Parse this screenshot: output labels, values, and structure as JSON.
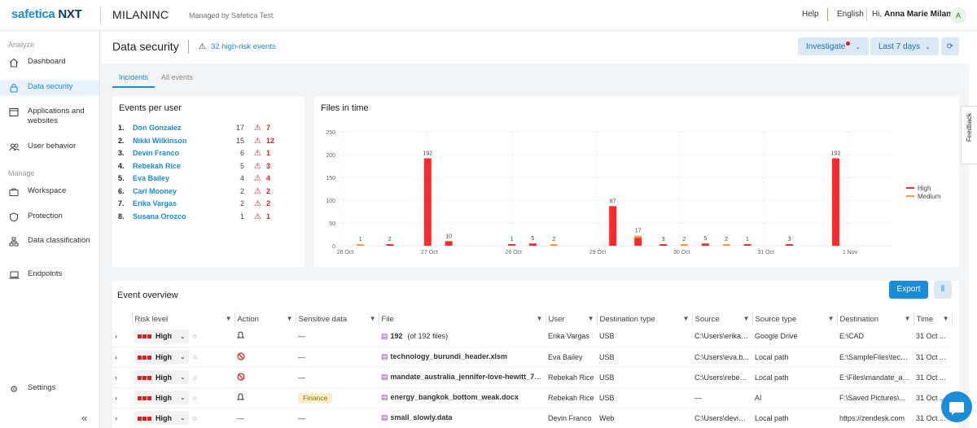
{
  "app": {
    "brand_main": "safetica",
    "brand_suffix": " NXT",
    "company": "MILANINC",
    "managed_by": "Managed by Safetica Test"
  },
  "topnav": {
    "help": "Help",
    "language": "English",
    "greeting": "Hi, ",
    "user_name": "Anna Marie Milan",
    "avatar_initial": "A"
  },
  "sidebar": {
    "analyze_title": "Analyze",
    "manage_title": "Manage",
    "items": [
      {
        "label": "Dashboard",
        "icon": "home-icon"
      },
      {
        "label": "Data security",
        "icon": "lock-icon",
        "active": true
      },
      {
        "label": "Applications and websites",
        "icon": "app-window-icon"
      },
      {
        "label": "User behavior",
        "icon": "users-icon"
      },
      {
        "label": "Workspace",
        "icon": "briefcase-icon"
      },
      {
        "label": "Protection",
        "icon": "shield-icon"
      },
      {
        "label": "Data classification",
        "icon": "hierarchy-icon"
      },
      {
        "label": "Endpoints",
        "icon": "laptop-icon"
      },
      {
        "label": "Settings",
        "icon": "gear-icon"
      }
    ]
  },
  "page": {
    "title": "Data security",
    "alert_text": "32 high-risk events",
    "investigate": "Investigate",
    "period": "Last 7 days",
    "tabs": [
      "Incidents",
      "All events"
    ]
  },
  "events_per_user": {
    "title": "Events per user",
    "rows": [
      {
        "rank": "1.",
        "name": "Don Gonzalez",
        "count": "17",
        "high": "7"
      },
      {
        "rank": "2.",
        "name": "Nikki Wilkinson",
        "count": "15",
        "high": "12"
      },
      {
        "rank": "3.",
        "name": "Devin Franco",
        "count": "6",
        "high": "1"
      },
      {
        "rank": "4.",
        "name": "Rebekah Rice",
        "count": "5",
        "high": "3"
      },
      {
        "rank": "5.",
        "name": "Eva Bailey",
        "count": "4",
        "high": "4"
      },
      {
        "rank": "6.",
        "name": "Carl Mooney",
        "count": "2",
        "high": "2"
      },
      {
        "rank": "7.",
        "name": "Erika Vargas",
        "count": "2",
        "high": "2"
      },
      {
        "rank": "8.",
        "name": "Susana Orozco",
        "count": "1",
        "high": "1"
      }
    ]
  },
  "chart_data": {
    "type": "bar",
    "title": "Files in time",
    "x_ticks": [
      "26 Oct",
      "27 Oct",
      "28 Oct",
      "29 Oct",
      "30 Oct",
      "31 Oct",
      "1 Nov"
    ],
    "ylim": [
      0,
      250
    ],
    "y_ticks": [
      0,
      50,
      100,
      150,
      200,
      250
    ],
    "grid": true,
    "legend_position": "right",
    "series": [
      {
        "name": "High",
        "color": "#ff2a2a"
      },
      {
        "name": "Medium",
        "color": "#f59b3c"
      }
    ],
    "points": [
      {
        "t": 0.2,
        "high": 0,
        "medium": 1,
        "label": "1"
      },
      {
        "t": 0.55,
        "high": 2,
        "medium": 0,
        "label": "2"
      },
      {
        "t": 1.0,
        "high": 192,
        "medium": 0,
        "label": "192"
      },
      {
        "t": 1.25,
        "high": 10,
        "medium": 0,
        "label": "10"
      },
      {
        "t": 2.0,
        "high": 1,
        "medium": 0,
        "label": "1"
      },
      {
        "t": 2.25,
        "high": 5,
        "medium": 0,
        "label": "5"
      },
      {
        "t": 2.5,
        "high": 0,
        "medium": 2,
        "label": "2"
      },
      {
        "t": 3.2,
        "high": 87,
        "medium": 0,
        "label": "87"
      },
      {
        "t": 3.5,
        "high": 17,
        "medium": 5,
        "label": "17"
      },
      {
        "t": 3.8,
        "high": 3,
        "medium": 0,
        "label": "3"
      },
      {
        "t": 4.05,
        "high": 0,
        "medium": 2,
        "label": "2"
      },
      {
        "t": 4.3,
        "high": 5,
        "medium": 0,
        "label": "5"
      },
      {
        "t": 4.55,
        "high": 0,
        "medium": 2,
        "label": "2"
      },
      {
        "t": 4.8,
        "high": 1,
        "medium": 0,
        "label": "1"
      },
      {
        "t": 5.3,
        "high": 3,
        "medium": 0,
        "label": "3"
      },
      {
        "t": 5.85,
        "high": 192,
        "medium": 0,
        "label": "192"
      }
    ]
  },
  "event_overview": {
    "title": "Event overview",
    "export": "Export",
    "columns": [
      "Risk level",
      "Action",
      "Sensitive data",
      "File",
      "User",
      "Destination type",
      "Source",
      "Source type",
      "Destination",
      "Time"
    ],
    "rows": [
      {
        "risk": "High",
        "action_icon": "bell-icon",
        "sensitive": "—",
        "file": "192",
        "file_extra": "(of 192 files)",
        "user": "Erika Vargas",
        "dest_type": "USB",
        "source": "C:\\Users\\erika.v...",
        "source_type": "Google Drive",
        "destination": "E:\\CAD",
        "time": "31 Oct ..."
      },
      {
        "risk": "High",
        "action_icon": "block-icon",
        "sensitive": "—",
        "file": "technology_burundi_header.xlsm",
        "file_extra": "",
        "user": "Eva Bailey",
        "dest_type": "USB",
        "source": "C:\\Users\\eva.b...",
        "source_type": "Local path",
        "destination": "E:\\SampleFiles\\techn...",
        "time": "31 Oct ..."
      },
      {
        "risk": "High",
        "action_icon": "block-icon",
        "sensitive": "—",
        "file": "mandate_australia_jennifer-love-hewitt_731...",
        "file_extra": "",
        "user": "Rebekah Rice",
        "dest_type": "USB",
        "source": "C:\\Users\\rebeka...",
        "source_type": "Local path",
        "destination": "E:\\Files\\mandate_aus...",
        "time": "31 Oct ..."
      },
      {
        "risk": "High",
        "action_icon": "bell-icon",
        "sensitive": "Finance",
        "file": "energy_bangkok_bottom_weak.docx",
        "file_extra": "",
        "user": "Rebekah Rice",
        "dest_type": "USB",
        "source": "—",
        "source_type": "AI",
        "destination": "F:\\Saved Pictures\\...",
        "time": "31 Oct ..."
      },
      {
        "risk": "High",
        "action_icon": "none",
        "sensitive": "—",
        "file": "small_slowly.data",
        "file_extra": "",
        "user": "Devin Franco",
        "dest_type": "Web",
        "source": "C:\\Users\\devin.f...",
        "source_type": "Local path",
        "destination": "https://zendesk.com",
        "time": "31 Oct ..."
      }
    ]
  },
  "feedback": "Feedback"
}
